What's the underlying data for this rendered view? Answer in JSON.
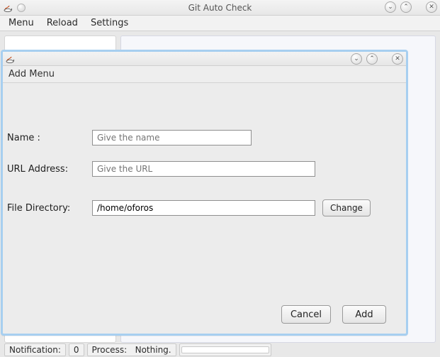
{
  "main_window": {
    "title": "Git Auto Check",
    "menubar": {
      "menu": "Menu",
      "reload": "Reload",
      "settings": "Settings"
    }
  },
  "dialog": {
    "heading": "Add Menu",
    "fields": {
      "name": {
        "label": "Name :",
        "placeholder": "Give the name",
        "value": ""
      },
      "url": {
        "label": "URL Address:",
        "placeholder": "Give the URL",
        "value": ""
      },
      "dir": {
        "label": "File Directory:",
        "value": "/home/oforos"
      }
    },
    "buttons": {
      "change": "Change",
      "cancel": "Cancel",
      "add": "Add"
    }
  },
  "statusbar": {
    "notification_label": "Notification:",
    "notification_count": "0",
    "process_label": "Process:",
    "process_value": "Nothing."
  },
  "glyphs": {
    "chevdown": "⌄",
    "chevup": "⌃",
    "close": "✕"
  }
}
